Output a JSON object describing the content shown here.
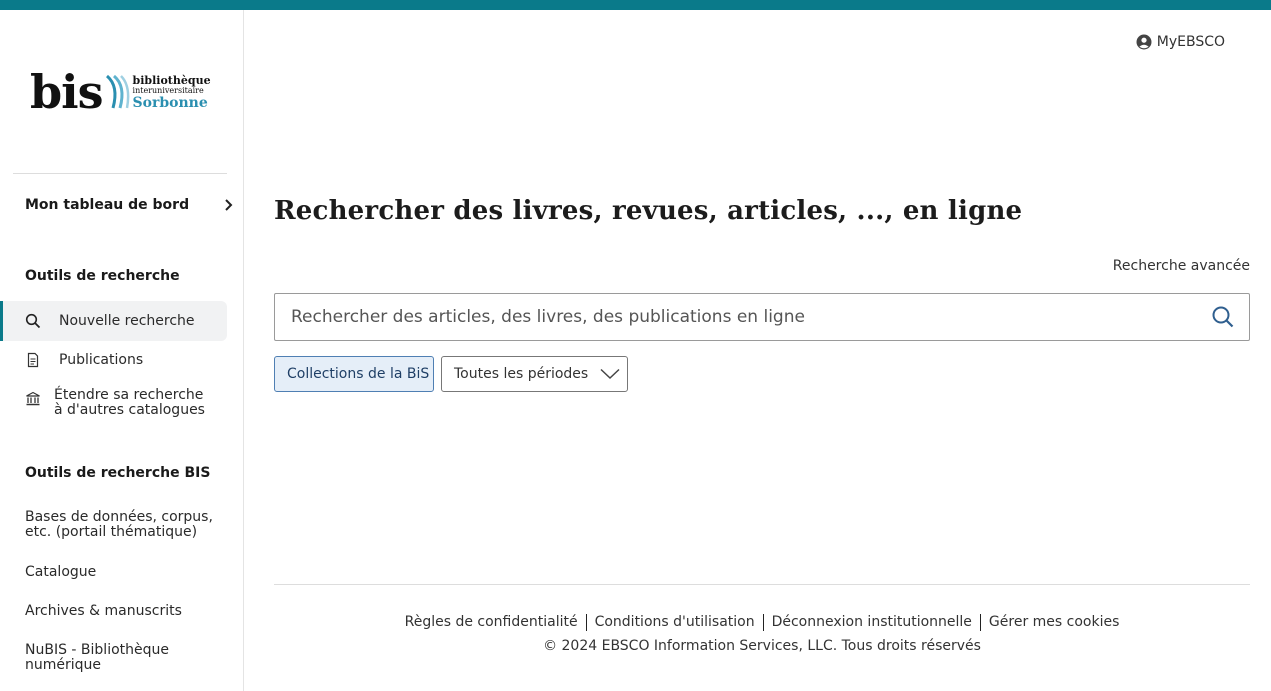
{
  "colors": {
    "topbar": "#0a7a8a",
    "accent": "#0a7a8a",
    "chip_bg": "#e5eef8",
    "chip_border": "#4f7fb3",
    "logo_blue": "#2a8fb0"
  },
  "logo": {
    "main": "bis",
    "line1": "bibliothèque",
    "line2": "interuniversitaire",
    "line3": "Sorbonne"
  },
  "header": {
    "myebsco_label": "MyEBSCO",
    "myebsco_icon": "user-circle-icon"
  },
  "sidebar": {
    "dashboard_label": "Mon tableau de bord",
    "search_tools_title": "Outils de recherche",
    "search_tools": [
      {
        "label": "Nouvelle recherche",
        "icon": "search-icon",
        "active": true
      },
      {
        "label": "Publications",
        "icon": "document-icon",
        "active": false
      },
      {
        "label": "Étendre sa recherche à d'autres catalogues",
        "icon": "institution-icon",
        "active": false
      }
    ],
    "bis_tools_title": "Outils de recherche BIS",
    "bis_links": [
      "Bases de données, corpus, etc. (portail thématique)",
      "Catalogue",
      "Archives & manuscrits",
      "NuBIS - Bibliothèque numérique"
    ]
  },
  "main": {
    "title": "Rechercher des livres, revues, articles, ..., en ligne",
    "advanced_search": "Recherche avancée",
    "search_placeholder": "Rechercher des articles, des livres, des publications en ligne",
    "filters": {
      "collection": "Collections de la BiS",
      "period": "Toutes les périodes"
    }
  },
  "footer": {
    "links": [
      "Règles de confidentialité",
      "Conditions d'utilisation",
      "Déconnexion institutionnelle",
      "Gérer mes cookies"
    ],
    "copyright": "© 2024 EBSCO Information Services, LLC. Tous droits réservés"
  }
}
